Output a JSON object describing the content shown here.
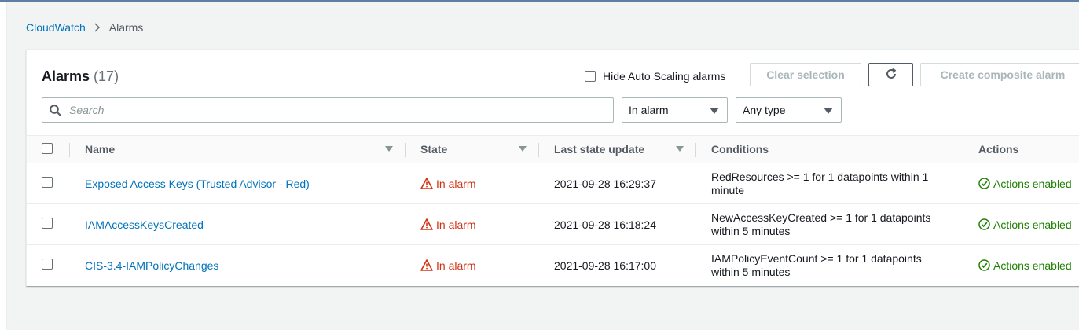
{
  "breadcrumb": {
    "root": "CloudWatch",
    "current": "Alarms"
  },
  "panel": {
    "title": "Alarms",
    "count": "(17)"
  },
  "toolbar": {
    "hide_autoscaling_label": "Hide Auto Scaling alarms",
    "clear_selection_label": "Clear selection",
    "create_composite_label": "Create composite alarm",
    "refresh_icon": "refresh-icon"
  },
  "filters": {
    "search_placeholder": "Search",
    "state_filter": "In alarm",
    "type_filter": "Any type"
  },
  "table": {
    "columns": {
      "name": "Name",
      "state": "State",
      "last_update": "Last state update",
      "conditions": "Conditions",
      "actions": "Actions"
    },
    "rows": [
      {
        "name": "Exposed Access Keys (Trusted Advisor - Red)",
        "state": "In alarm",
        "last_update": "2021-09-28 16:29:37",
        "conditions": "RedResources >= 1 for 1 datapoints within 1 minute",
        "actions": "Actions enabled"
      },
      {
        "name": "IAMAccessKeysCreated",
        "state": "In alarm",
        "last_update": "2021-09-28 16:18:24",
        "conditions": "NewAccessKeyCreated >= 1 for 1 datapoints within 5 minutes",
        "actions": "Actions enabled"
      },
      {
        "name": "CIS-3.4-IAMPolicyChanges",
        "state": "In alarm",
        "last_update": "2021-09-28 16:17:00",
        "conditions": "IAMPolicyEventCount >= 1 for 1 datapoints within 5 minutes",
        "actions": "Actions enabled"
      }
    ]
  },
  "colors": {
    "link": "#0073bb",
    "alarm": "#d13212",
    "enabled": "#1d8102"
  }
}
